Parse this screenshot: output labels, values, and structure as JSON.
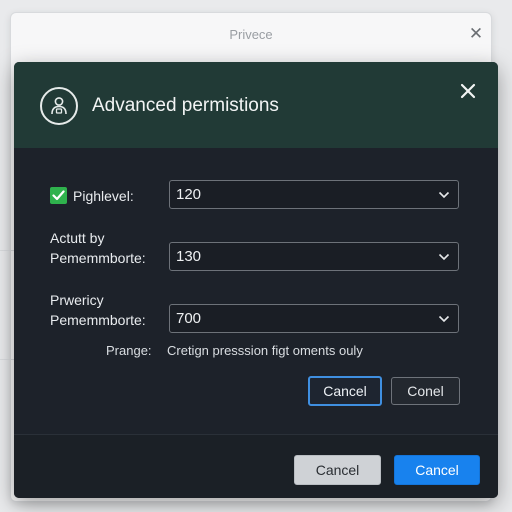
{
  "background_window": {
    "title": "Privece"
  },
  "dialog": {
    "title": "Advanced permistions",
    "rows": [
      {
        "label": "Pighlevel:",
        "value": "120",
        "checked": true
      },
      {
        "label_line1": "Actutt by",
        "label_line2": "Pememmborte:",
        "value": "130"
      },
      {
        "label_line1": "Prwericy",
        "label_line2": "Pememmborte:",
        "value": "700"
      }
    ],
    "note_label": "Prange:",
    "note_text": "Cretign presssion figt oments ouly",
    "inline_buttons": {
      "cancel_active": "Cancel",
      "cancel_outline": "Conel"
    },
    "footer_buttons": {
      "cancel_grey": "Cancel",
      "cancel_blue": "Cancel"
    }
  },
  "colors": {
    "header_bg": "#213a36",
    "body_bg": "#1d222a",
    "accent_blue": "#1882ee",
    "check_green": "#2fb24d"
  },
  "icons": {
    "background_close": "close-icon",
    "header": "user-lock-icon",
    "dialog_close": "close-icon",
    "select_chevron": "chevron-down-icon",
    "checkbox": "check-icon"
  }
}
